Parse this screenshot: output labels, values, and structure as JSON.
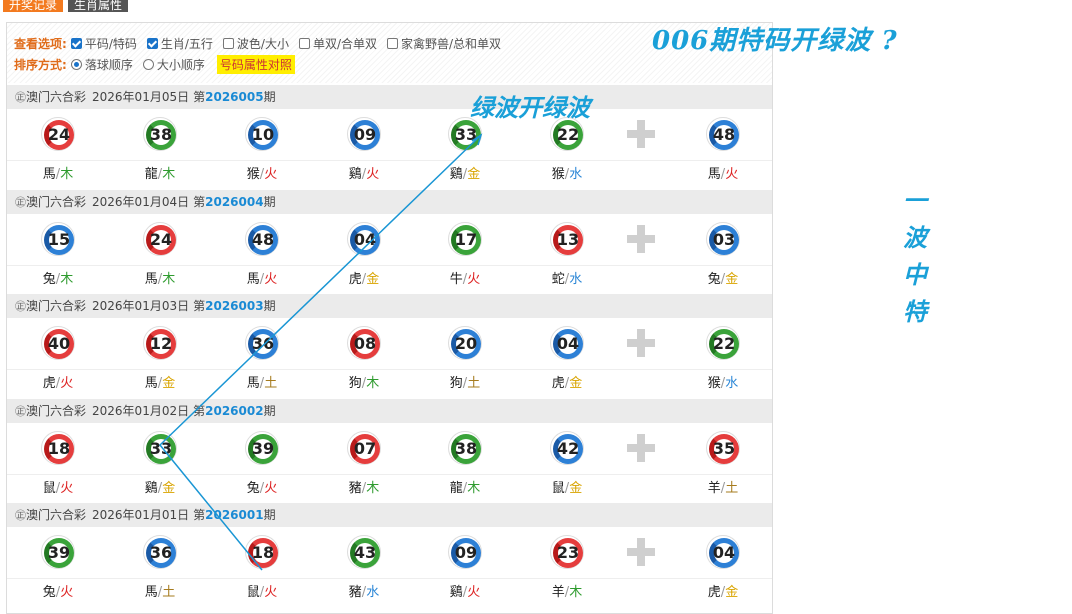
{
  "tabs": [
    "开奖记录",
    "生肖属性"
  ],
  "filter": {
    "view_label": "查看选项:",
    "view_options": [
      {
        "label": "平码/特码",
        "checked": true
      },
      {
        "label": "生肖/五行",
        "checked": true
      },
      {
        "label": "波色/大小",
        "checked": false
      },
      {
        "label": "单双/合单双",
        "checked": false
      },
      {
        "label": "家禽野兽/总和单双",
        "checked": false
      }
    ],
    "sort_label": "排序方式:",
    "sort_options": [
      {
        "label": "落球顺序",
        "checked": true
      },
      {
        "label": "大小顺序",
        "checked": false
      }
    ],
    "compare_button": "号码属性对照"
  },
  "annotations": {
    "title": "006期特码开绿波 ?",
    "mid": "绿波开绿波",
    "side": "一波中特"
  },
  "draws": [
    {
      "mark": "㊣",
      "lottery": "澳门六合彩",
      "date": "2026年01月05日",
      "prefix": "第",
      "issue": "2026005",
      "suffix": "期",
      "balls": [
        {
          "num": "24",
          "color": "red",
          "zodiac": "馬",
          "element": "木"
        },
        {
          "num": "38",
          "color": "green",
          "zodiac": "龍",
          "element": "木"
        },
        {
          "num": "10",
          "color": "blue",
          "zodiac": "猴",
          "element": "火"
        },
        {
          "num": "09",
          "color": "blue",
          "zodiac": "鷄",
          "element": "火"
        },
        {
          "num": "33",
          "color": "green",
          "zodiac": "鷄",
          "element": "金"
        },
        {
          "num": "22",
          "color": "green",
          "zodiac": "猴",
          "element": "水"
        },
        {
          "num": "48",
          "color": "blue",
          "zodiac": "馬",
          "element": "火"
        }
      ]
    },
    {
      "mark": "㊣",
      "lottery": "澳门六合彩",
      "date": "2026年01月04日",
      "prefix": "第",
      "issue": "2026004",
      "suffix": "期",
      "balls": [
        {
          "num": "15",
          "color": "blue",
          "zodiac": "兔",
          "element": "木"
        },
        {
          "num": "24",
          "color": "red",
          "zodiac": "馬",
          "element": "木"
        },
        {
          "num": "48",
          "color": "blue",
          "zodiac": "馬",
          "element": "火"
        },
        {
          "num": "04",
          "color": "blue",
          "zodiac": "虎",
          "element": "金"
        },
        {
          "num": "17",
          "color": "green",
          "zodiac": "牛",
          "element": "火"
        },
        {
          "num": "13",
          "color": "red",
          "zodiac": "蛇",
          "element": "水"
        },
        {
          "num": "03",
          "color": "blue",
          "zodiac": "兔",
          "element": "金"
        }
      ]
    },
    {
      "mark": "㊣",
      "lottery": "澳门六合彩",
      "date": "2026年01月03日",
      "prefix": "第",
      "issue": "2026003",
      "suffix": "期",
      "balls": [
        {
          "num": "40",
          "color": "red",
          "zodiac": "虎",
          "element": "火"
        },
        {
          "num": "12",
          "color": "red",
          "zodiac": "馬",
          "element": "金"
        },
        {
          "num": "36",
          "color": "blue",
          "zodiac": "馬",
          "element": "土"
        },
        {
          "num": "08",
          "color": "red",
          "zodiac": "狗",
          "element": "木"
        },
        {
          "num": "20",
          "color": "blue",
          "zodiac": "狗",
          "element": "土"
        },
        {
          "num": "04",
          "color": "blue",
          "zodiac": "虎",
          "element": "金"
        },
        {
          "num": "22",
          "color": "green",
          "zodiac": "猴",
          "element": "水"
        }
      ]
    },
    {
      "mark": "㊣",
      "lottery": "澳门六合彩",
      "date": "2026年01月02日",
      "prefix": "第",
      "issue": "2026002",
      "suffix": "期",
      "balls": [
        {
          "num": "18",
          "color": "red",
          "zodiac": "鼠",
          "element": "火"
        },
        {
          "num": "33",
          "color": "green",
          "zodiac": "鷄",
          "element": "金"
        },
        {
          "num": "39",
          "color": "green",
          "zodiac": "兔",
          "element": "火"
        },
        {
          "num": "07",
          "color": "red",
          "zodiac": "豬",
          "element": "木"
        },
        {
          "num": "38",
          "color": "green",
          "zodiac": "龍",
          "element": "木"
        },
        {
          "num": "42",
          "color": "blue",
          "zodiac": "鼠",
          "element": "金"
        },
        {
          "num": "35",
          "color": "red",
          "zodiac": "羊",
          "element": "土"
        }
      ]
    },
    {
      "mark": "㊣",
      "lottery": "澳门六合彩",
      "date": "2026年01月01日",
      "prefix": "第",
      "issue": "2026001",
      "suffix": "期",
      "balls": [
        {
          "num": "39",
          "color": "green",
          "zodiac": "兔",
          "element": "火"
        },
        {
          "num": "36",
          "color": "blue",
          "zodiac": "馬",
          "element": "土"
        },
        {
          "num": "18",
          "color": "red",
          "zodiac": "鼠",
          "element": "火"
        },
        {
          "num": "43",
          "color": "green",
          "zodiac": "豬",
          "element": "水"
        },
        {
          "num": "09",
          "color": "blue",
          "zodiac": "鷄",
          "element": "火"
        },
        {
          "num": "23",
          "color": "red",
          "zodiac": "羊",
          "element": "木"
        },
        {
          "num": "04",
          "color": "blue",
          "zodiac": "虎",
          "element": "金"
        }
      ]
    }
  ],
  "colors": {
    "accent_orange": "#f37a1f",
    "annotation_blue": "#1aa0d8",
    "red_ball": "#e53d3d",
    "blue_ball": "#2d80d6",
    "green_ball": "#3aa33a"
  }
}
